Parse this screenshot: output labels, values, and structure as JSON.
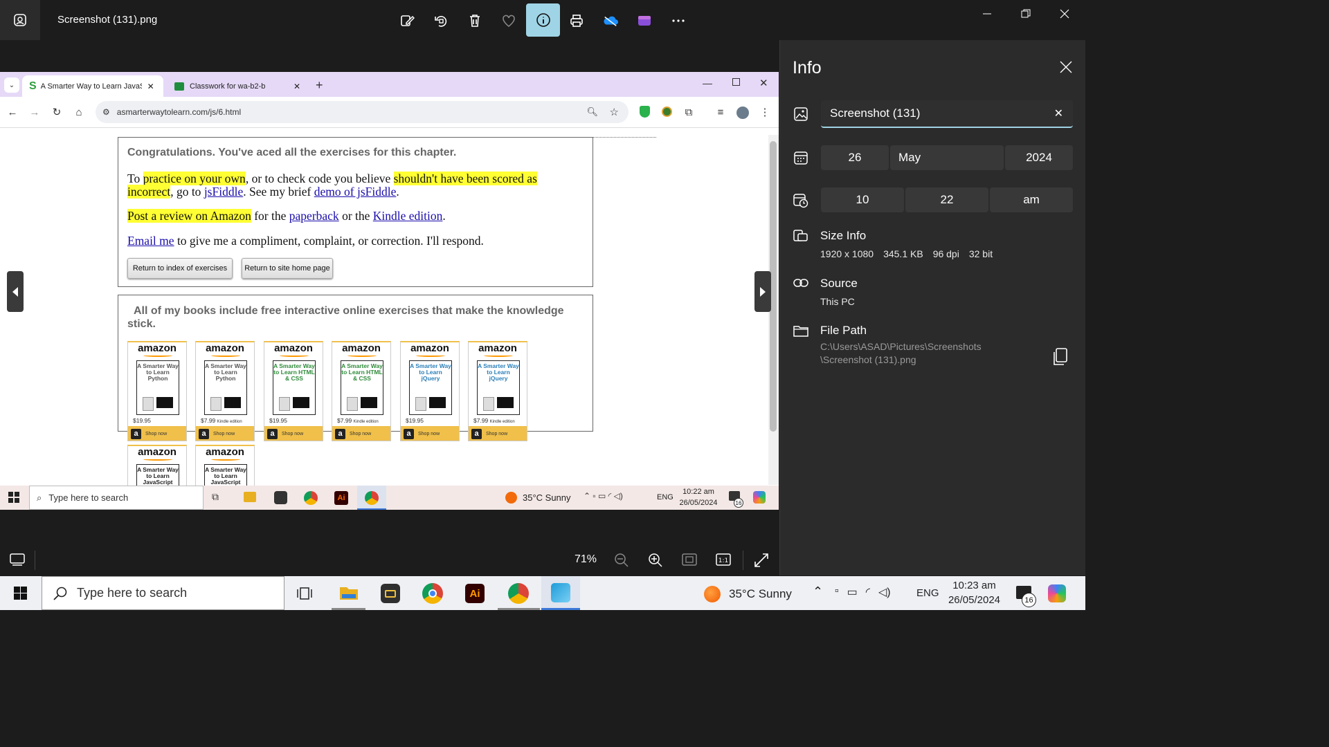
{
  "app": {
    "title": "Screenshot (131).png",
    "toolbar": [
      "edit-icon",
      "rotate-icon",
      "delete-icon",
      "favorite-icon",
      "info-icon",
      "print-icon",
      "onedrive-icon",
      "clipchamp-icon",
      "more-icon"
    ]
  },
  "browser": {
    "tabs": [
      {
        "label": "A Smarter Way to Learn JavaScr",
        "icon": "S"
      },
      {
        "label": "Classwork for wa-b2-b"
      }
    ],
    "url": "asmarterwaytolearn.com/js/6.html"
  },
  "webpage": {
    "heading": "Congratulations. You've aced all the exercises for this chapter.",
    "p1": {
      "t1": "To ",
      "hl1": "practice on your own",
      "t2": ", or to check code you believe ",
      "hl2": "shouldn't have been scored as incorrect",
      "t3": ", go to ",
      "link1": "jsFiddle",
      "t4": ". See my brief ",
      "link2": "demo of jsFiddle",
      "t5": "."
    },
    "p2": {
      "hl": "Post a review on Amazon",
      "t1": " for the ",
      "link1": "paperback",
      "t2": " or the ",
      "link2": "Kindle edition",
      "t3": "."
    },
    "p3": {
      "link": "Email me",
      "text": " to give me a compliment, complaint, or correction. I'll respond."
    },
    "buttons": [
      "Return to index of exercises",
      "Return to site home page"
    ],
    "books_heading": "All of my books include free interactive online exercises that make the knowledge stick.",
    "books": [
      {
        "title": "A Smarter Way to Learn Python",
        "price": "$19.95",
        "edition": "",
        "color": "#555555"
      },
      {
        "title": "A Smarter Way to Learn Python",
        "price": "$7.99",
        "edition": "Kindle edition",
        "color": "#555555"
      },
      {
        "title": "A Smarter Way to Learn HTML & CSS",
        "price": "$19.95",
        "edition": "",
        "color": "#2e8b3a"
      },
      {
        "title": "A Smarter Way to Learn HTML & CSS",
        "price": "$7.99",
        "edition": "Kindle edition",
        "color": "#2e8b3a"
      },
      {
        "title": "A Smarter Way to Learn jQuery",
        "price": "$19.95",
        "edition": "",
        "color": "#2a7fb8"
      },
      {
        "title": "A Smarter Way to Learn jQuery",
        "price": "$7.99",
        "edition": "Kindle edition",
        "color": "#2a7fb8"
      },
      {
        "title": "A Smarter Way to Learn JavaScript",
        "price": "",
        "edition": "",
        "color": "#222222"
      },
      {
        "title": "A Smarter Way to Learn JavaScript",
        "price": "",
        "edition": "",
        "color": "#222222"
      }
    ],
    "amazon": "amazon",
    "shop_now": "Shop now"
  },
  "inner_taskbar": {
    "search": "Type here to search",
    "weather": "35°C  Sunny",
    "lang": "ENG",
    "time": "10:22 am",
    "date": "26/05/2024",
    "badge": "16"
  },
  "info_panel": {
    "title": "Info",
    "name": "Screenshot (131)",
    "date": {
      "day": "26",
      "month": "May",
      "year": "2024"
    },
    "time": {
      "hour": "10",
      "minute": "22",
      "ampm": "am"
    },
    "size_label": "Size Info",
    "size": {
      "dims": "1920 x 1080",
      "filesize": "345.1 KB",
      "dpi": "96 dpi",
      "bits": "32 bit"
    },
    "source_label": "Source",
    "source": "This PC",
    "path_label": "File Path",
    "path_line1": "C:\\Users\\ASAD\\Pictures\\Screenshots",
    "path_line2": "\\Screenshot (131).png"
  },
  "viewer": {
    "zoom": "71%"
  },
  "taskbar": {
    "search": "Type here to search",
    "weather": "35°C  Sunny",
    "lang": "ENG",
    "time": "10:23 am",
    "date": "26/05/2024",
    "badge": "16"
  },
  "colors": {
    "accent": "#9fd4e6",
    "highlight": "#ffff33",
    "link": "#1a0dab",
    "amazon_orange": "#f90"
  }
}
